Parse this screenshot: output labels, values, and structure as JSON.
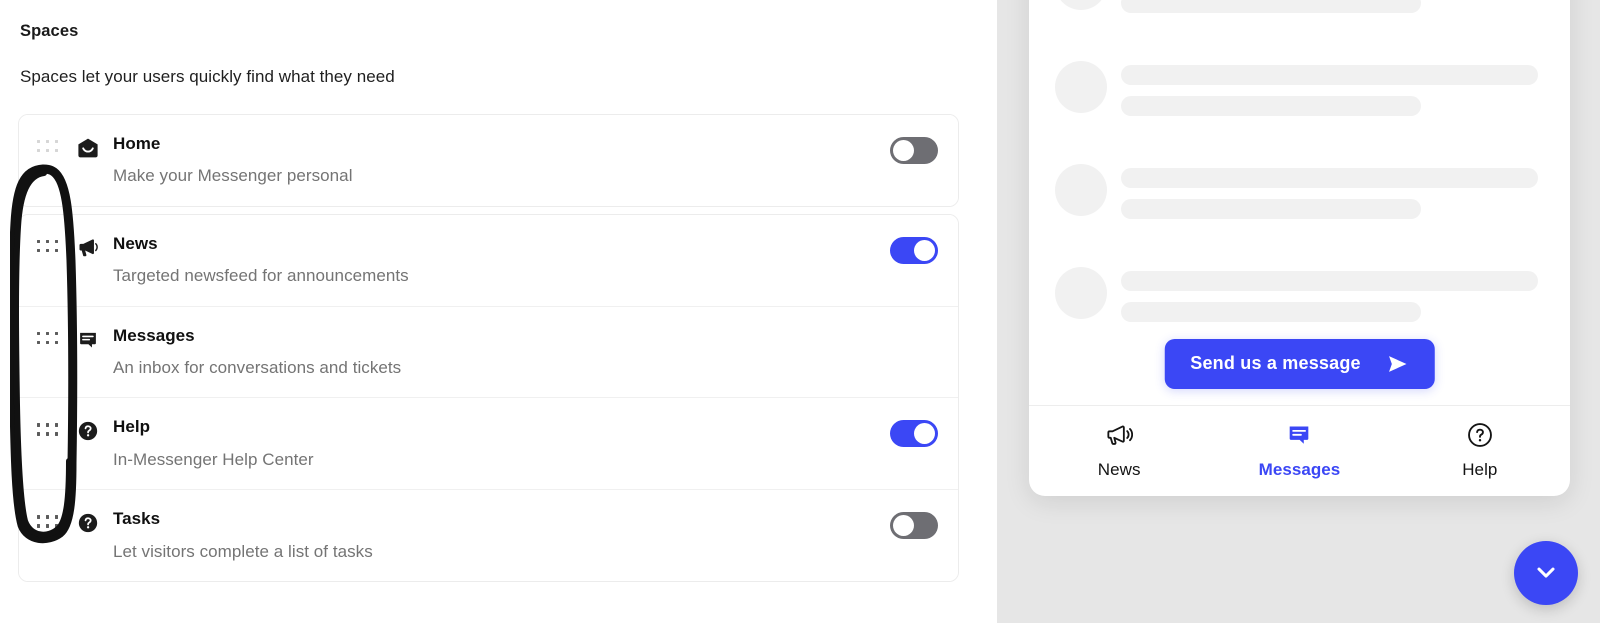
{
  "settings": {
    "section_title": "Spaces",
    "section_subtitle": "Spaces let your users quickly find what they need",
    "rows": [
      {
        "id": "home",
        "icon": "envelope-icon",
        "title": "Home",
        "description": "Make your Messenger personal",
        "toggle": "off",
        "has_toggle": true
      },
      {
        "id": "news",
        "icon": "megaphone-icon",
        "title": "News",
        "description": "Targeted newsfeed for announcements",
        "toggle": "on",
        "has_toggle": true
      },
      {
        "id": "messages",
        "icon": "chat-bubble-icon",
        "title": "Messages",
        "description": "An inbox for conversations and tickets",
        "toggle": "",
        "has_toggle": false
      },
      {
        "id": "help",
        "icon": "question-circle-icon",
        "title": "Help",
        "description": "In-Messenger Help Center",
        "toggle": "on",
        "has_toggle": true
      },
      {
        "id": "tasks",
        "icon": "question-circle-icon",
        "title": "Tasks",
        "description": "Let visitors complete a list of tasks",
        "toggle": "off",
        "has_toggle": true
      }
    ],
    "drag_handle_icon": "drag-handle-icon",
    "annotation": {
      "shape": "hand-drawn-oval",
      "color": "#111111",
      "encircles": "drag handles of News, Messages, Help and Tasks rows"
    }
  },
  "preview": {
    "send_button": {
      "label": "Send us a message",
      "icon": "paper-plane-icon"
    },
    "nav": [
      {
        "id": "news",
        "label": "News",
        "icon": "megaphone-outline-icon",
        "active": false
      },
      {
        "id": "messages",
        "label": "Messages",
        "icon": "chat-bubble-filled-icon",
        "active": true
      },
      {
        "id": "help",
        "label": "Help",
        "icon": "question-circle-outline-icon",
        "active": false
      }
    ],
    "launcher_button_icon": "chevron-down-icon",
    "skeleton_rows": 3
  },
  "colors": {
    "accent": "#3b47f5",
    "toggle_off": "#6e6e73",
    "title_text": "#101010",
    "muted_text": "#747474",
    "skeleton": "#f1f1f1",
    "preview_backdrop": "#e6e6e6",
    "annotation": "#111111"
  }
}
